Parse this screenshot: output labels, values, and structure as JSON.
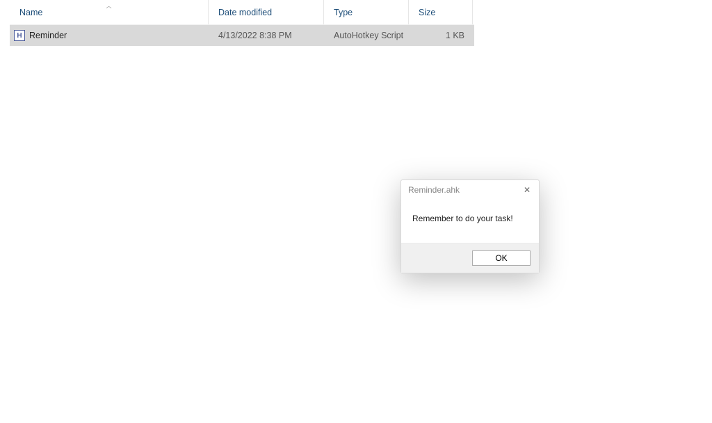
{
  "columns": {
    "name": "Name",
    "date": "Date modified",
    "type": "Type",
    "size": "Size"
  },
  "files": [
    {
      "icon_glyph": "H",
      "name": "Reminder",
      "date": "4/13/2022 8:38 PM",
      "type": "AutoHotkey Script",
      "size": "1 KB"
    }
  ],
  "dialog": {
    "title": "Reminder.ahk",
    "message": "Remember to do your task!",
    "ok_label": "OK"
  }
}
